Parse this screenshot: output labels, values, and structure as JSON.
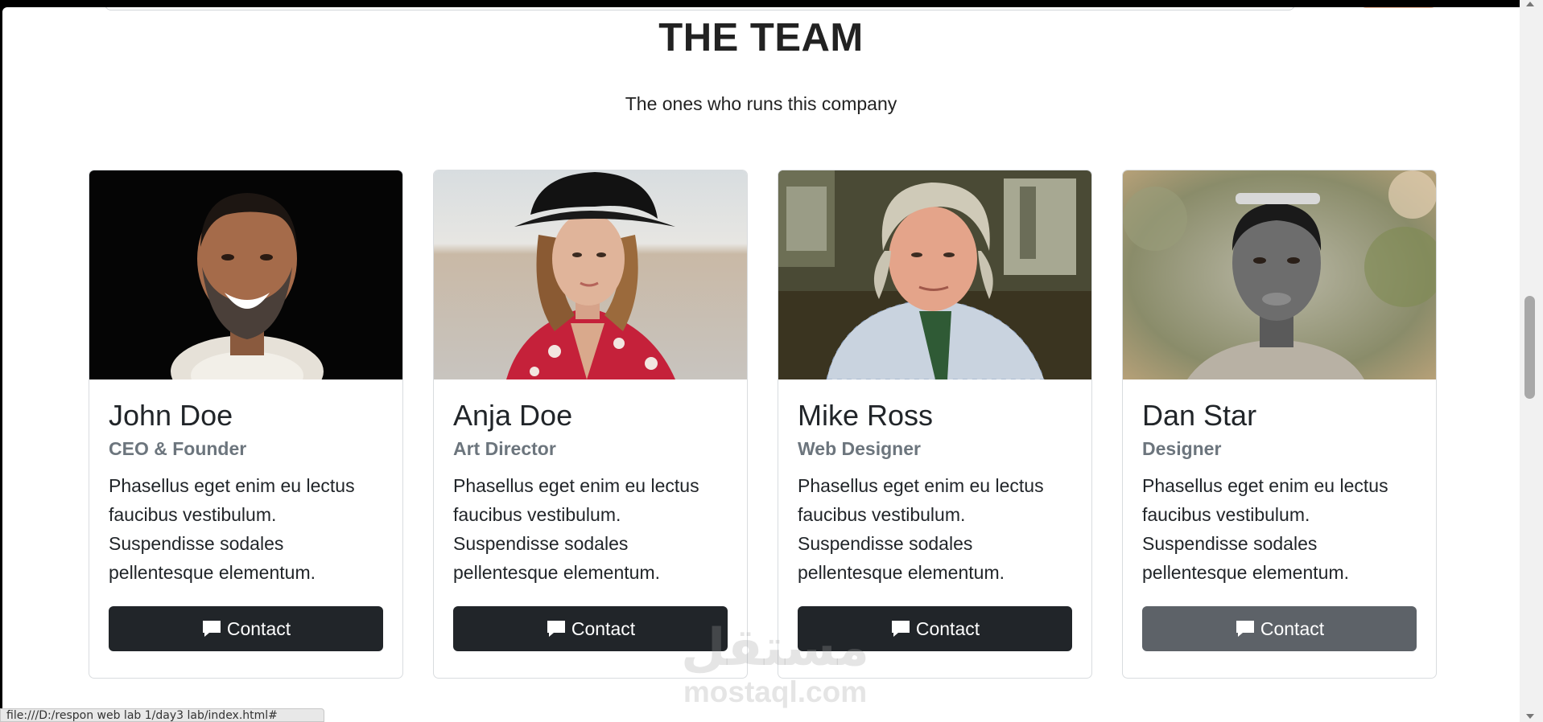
{
  "section": {
    "title": "THE TEAM",
    "subtitle": "The ones who runs this company"
  },
  "members": [
    {
      "name": "John Doe",
      "role": "CEO & Founder",
      "description": "Phasellus eget enim eu lectus faucibus vestibulum. Suspendisse sodales pellentesque elementum.",
      "button_label": "Contact",
      "button_color": "#212529"
    },
    {
      "name": "Anja Doe",
      "role": "Art Director",
      "description": "Phasellus eget enim eu lectus faucibus vestibulum. Suspendisse sodales pellentesque elementum.",
      "button_label": "Contact",
      "button_color": "#212529"
    },
    {
      "name": "Mike Ross",
      "role": "Web Designer",
      "description": "Phasellus eget enim eu lectus faucibus vestibulum. Suspendisse sodales pellentesque elementum.",
      "button_label": "Contact",
      "button_color": "#212529"
    },
    {
      "name": "Dan Star",
      "role": "Designer",
      "description": "Phasellus eget enim eu lectus faucibus vestibulum. Suspendisse sodales pellentesque elementum.",
      "button_label": "Contact",
      "button_color": "#5d6268"
    }
  ],
  "status_bar": {
    "url": "file:///D:/respon web lab 1/day3 lab/index.html#"
  },
  "watermark": {
    "arabic": "مستقل",
    "latin": "mostaql.com"
  },
  "icons": {
    "contact": "chat-bubble-icon"
  }
}
